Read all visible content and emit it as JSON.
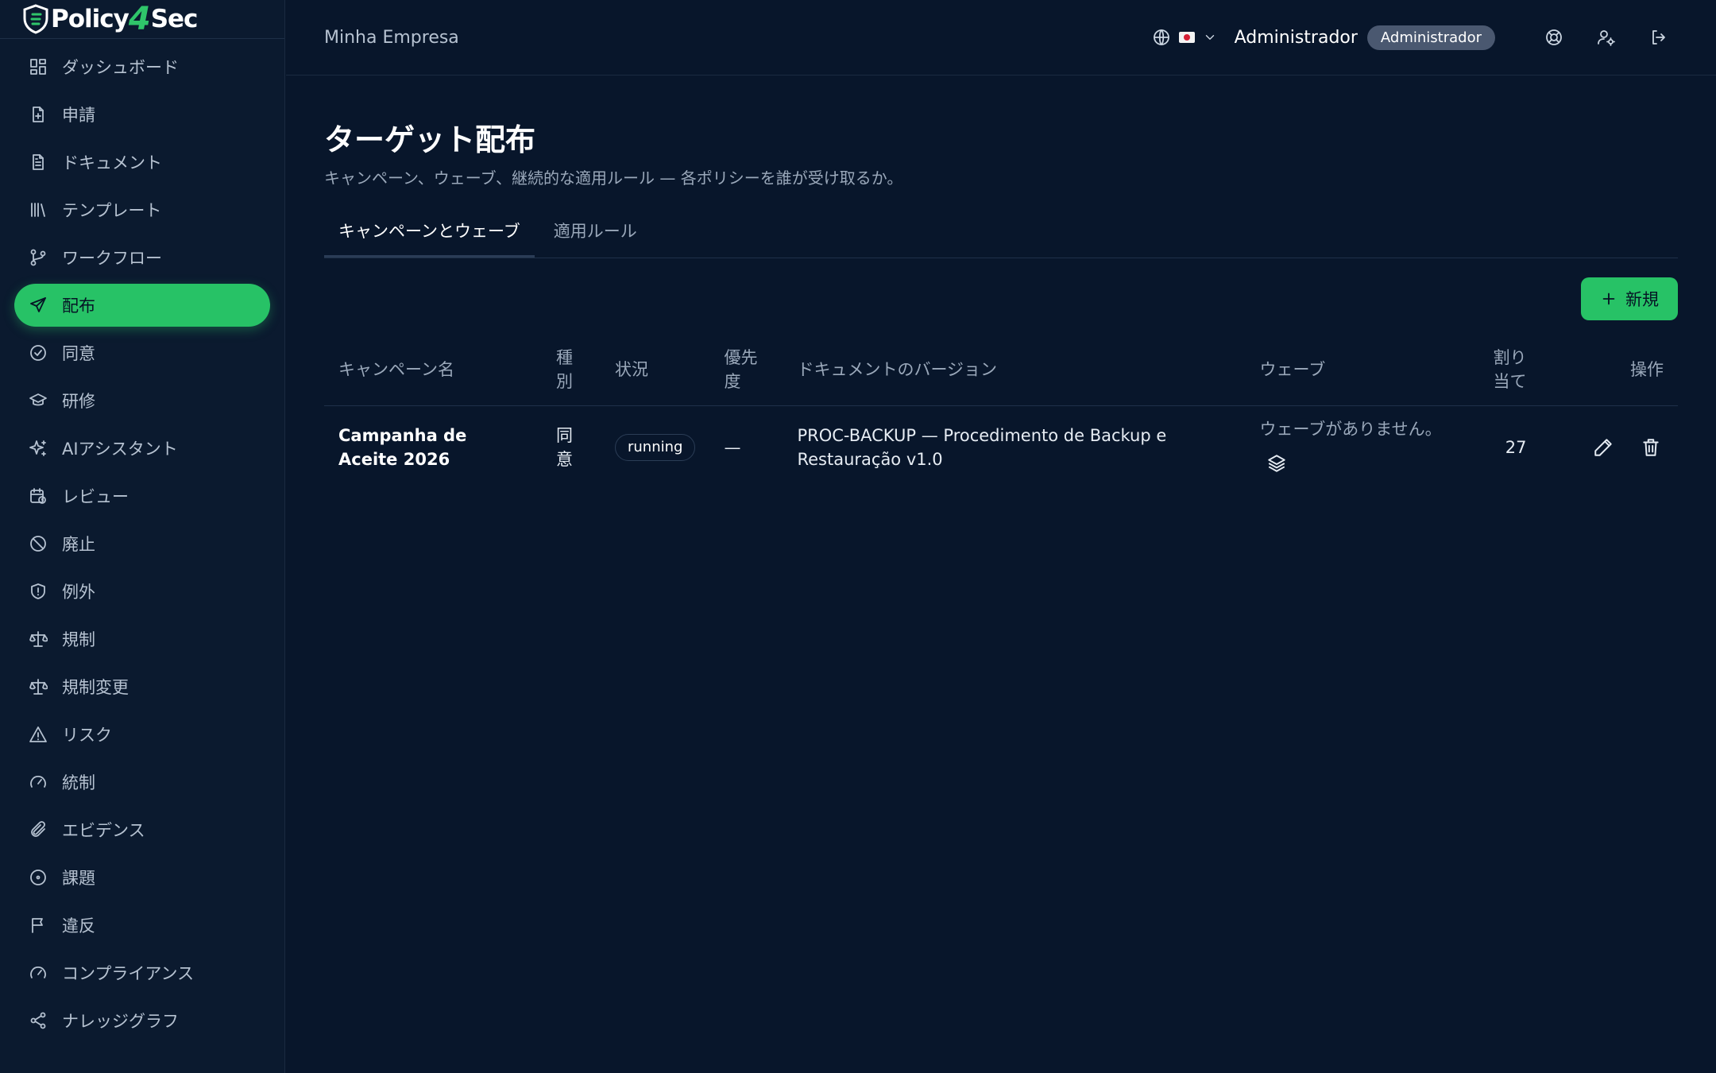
{
  "brand": {
    "part1": "Policy",
    "part2": "4",
    "part3": "Sec"
  },
  "sidebar": {
    "items": [
      {
        "label": "ダッシュボード",
        "icon": "dashboard-icon"
      },
      {
        "label": "申請",
        "icon": "file-plus-icon"
      },
      {
        "label": "ドキュメント",
        "icon": "document-icon"
      },
      {
        "label": "テンプレート",
        "icon": "library-icon"
      },
      {
        "label": "ワークフロー",
        "icon": "git-branch-icon"
      },
      {
        "label": "配布",
        "icon": "send-icon",
        "active": true
      },
      {
        "label": "同意",
        "icon": "check-circle-icon"
      },
      {
        "label": "研修",
        "icon": "graduation-cap-icon"
      },
      {
        "label": "AIアシスタント",
        "icon": "sparkles-icon"
      },
      {
        "label": "レビュー",
        "icon": "calendar-clock-icon"
      },
      {
        "label": "廃止",
        "icon": "ban-icon"
      },
      {
        "label": "例外",
        "icon": "shield-alert-icon"
      },
      {
        "label": "規制",
        "icon": "scale-icon"
      },
      {
        "label": "規制変更",
        "icon": "scale-icon"
      },
      {
        "label": "リスク",
        "icon": "alert-triangle-icon"
      },
      {
        "label": "統制",
        "icon": "gauge-icon"
      },
      {
        "label": "エビデンス",
        "icon": "paperclip-icon"
      },
      {
        "label": "課題",
        "icon": "dot-circle-icon"
      },
      {
        "label": "違反",
        "icon": "flag-icon"
      },
      {
        "label": "コンプライアンス",
        "icon": "gauge-icon"
      },
      {
        "label": "ナレッジグラフ",
        "icon": "share-icon"
      }
    ]
  },
  "header": {
    "company": "Minha Empresa",
    "user_name": "Administrador",
    "role_badge": "Administrador"
  },
  "main": {
    "title": "ターゲット配布",
    "subtitle": "キャンペーン、ウェーブ、継続的な適用ルール — 各ポリシーを誰が受け取るか。",
    "tabs": [
      {
        "label": "キャンペーンとウェーブ",
        "active": true
      },
      {
        "label": "適用ルール",
        "active": false
      }
    ],
    "new_button": "新規",
    "table": {
      "columns": {
        "name": "キャンペーン名",
        "type": "種別",
        "status": "状況",
        "priority": "優先度",
        "doc": "ドキュメントのバージョン",
        "wave": "ウェーブ",
        "assign": "割り当て",
        "ops": "操作"
      },
      "rows": [
        {
          "name": "Campanha de Aceite 2026",
          "type": "同意",
          "status": "running",
          "priority": "—",
          "doc": "PROC-BACKUP — Procedimento de Backup e Restauração v1.0",
          "wave": "ウェーブがありません。",
          "assign": "27"
        }
      ]
    }
  },
  "colors": {
    "background": "#08162b",
    "sidebar": "#0b1a2f",
    "accent": "#27c266"
  }
}
